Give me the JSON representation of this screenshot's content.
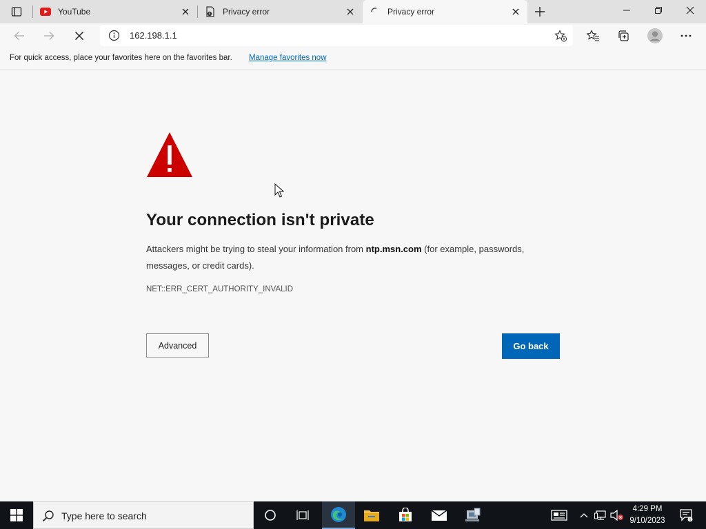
{
  "browser": {
    "tabs": [
      {
        "title": "YouTube",
        "favicon": "youtube-icon",
        "active": false
      },
      {
        "title": "Privacy error",
        "favicon": "page-error-icon",
        "active": false
      },
      {
        "title": "Privacy error",
        "favicon": "loading-spinner-icon",
        "active": true
      }
    ],
    "address": "162.198.1.1",
    "favorites_bar": {
      "message": "For quick access, place your favorites here on the favorites bar.",
      "link": "Manage favorites now"
    }
  },
  "page": {
    "heading": "Your connection isn't private",
    "desc_before": "Attackers might be trying to steal your information from ",
    "desc_host": "ntp.msn.com",
    "desc_after": " (for example, passwords, messages, or credit cards).",
    "error_code": "NET::ERR_CERT_AUTHORITY_INVALID",
    "advanced_label": "Advanced",
    "go_back_label": "Go back",
    "warning_color": "#cc0000",
    "button_color": "#0067b8"
  },
  "taskbar": {
    "search_placeholder": "Type here to search",
    "time": "4:29 PM",
    "date": "9/10/2023"
  }
}
